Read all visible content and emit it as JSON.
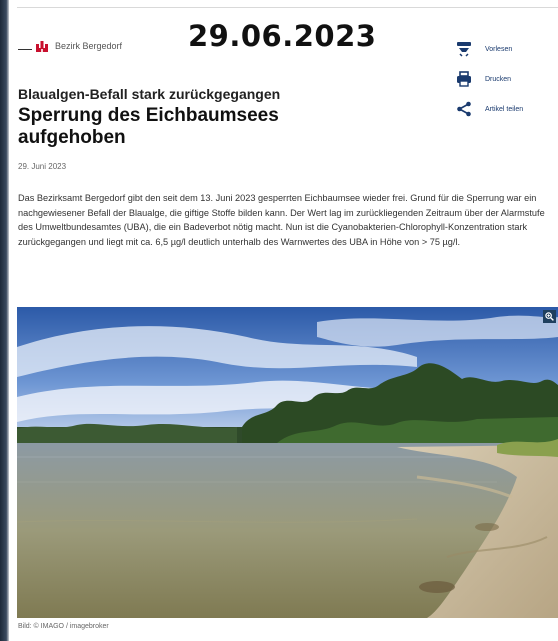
{
  "overlay_date": "29.06.2023",
  "header": {
    "district_label": "Bezirk Bergedorf"
  },
  "actions": {
    "read_aloud": "Vorlesen",
    "print": "Drucken",
    "share": "Artikel teilen"
  },
  "article": {
    "kicker": "Blaualgen-Befall stark zurückgegangen",
    "headline": "Sperrung des Eichbaumsees aufgehoben",
    "date": "29. Juni 2023",
    "body": "Das Bezirksamt Bergedorf gibt den seit dem 13. Juni 2023 gesperrten Eichbaumsee wieder frei. Grund für die Sperrung war ein nachgewiesener Befall der Blaualge, die giftige Stoffe bilden kann. Der Wert lag im zurückliegenden Zeitraum über der Alarmstufe des Umweltbundesamtes (UBA), die ein Badeverbot nötig macht. Nun ist die Cyanobakterien-Chlorophyll-Konzentration stark zurückgegangen und liegt mit ca. 6,5 µg/l deutlich unterhalb des Warnwertes des UBA in Höhe von > 75 µg/l.",
    "image_caption": "Bild: © IMAGO / imagebroker"
  },
  "colors": {
    "accent": "#1a3a6e",
    "logo_red": "#c8102e",
    "zoom_bg": "#1f3f5e"
  },
  "icons": {
    "read_aloud": "speaker-icon",
    "print": "printer-icon",
    "share": "share-icon",
    "zoom": "magnifier-plus-icon"
  }
}
